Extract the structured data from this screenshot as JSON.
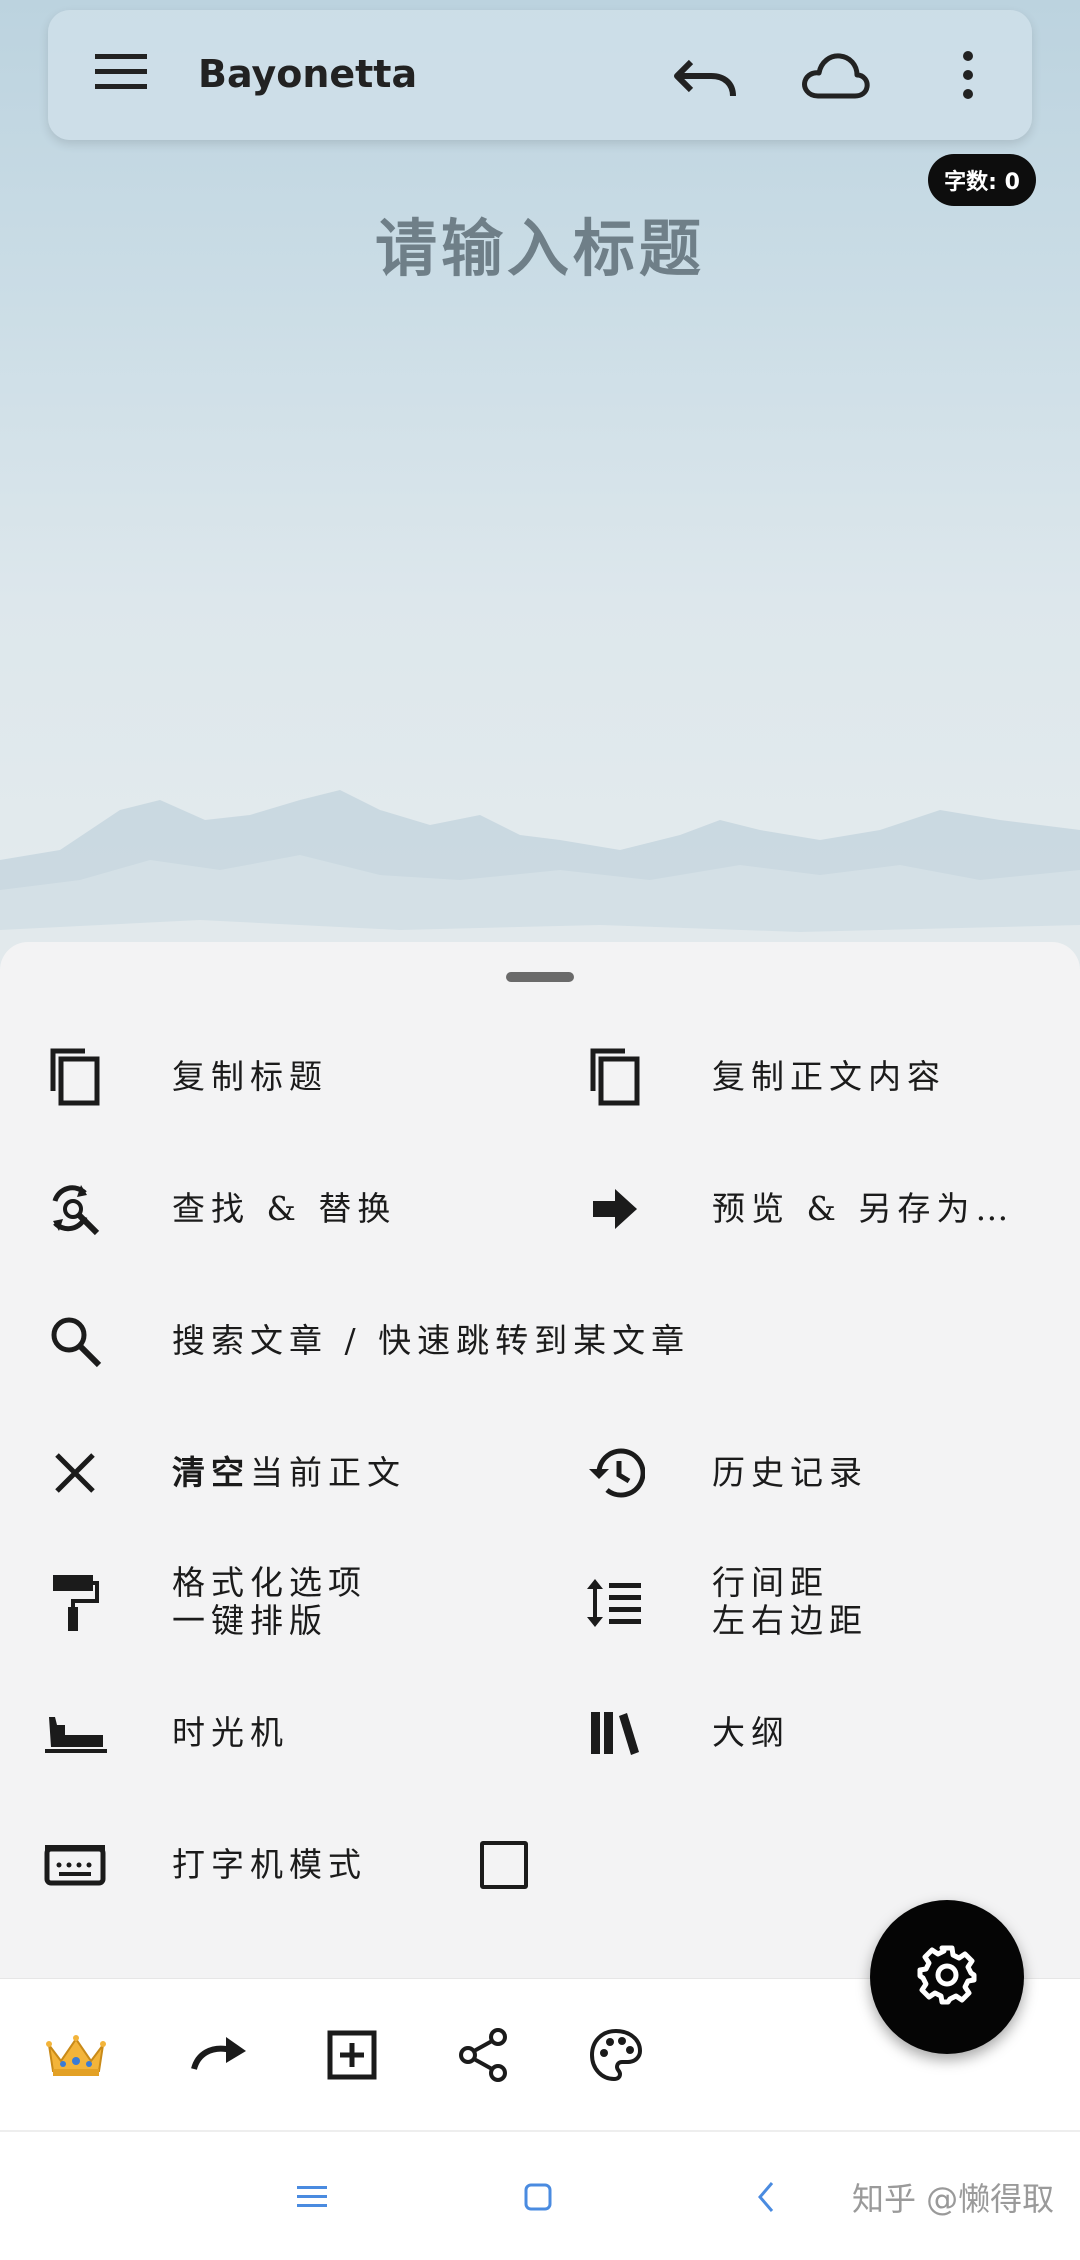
{
  "app": {
    "title": "Bayonetta",
    "word_count": "字数: 0",
    "title_placeholder": "请输入标题"
  },
  "menu": {
    "copy_title": "复制标题",
    "copy_body": "复制正文内容",
    "find_replace": "查找 & 替换",
    "preview_save": "预览 & 另存为…",
    "search_jump": "搜索文章 / 快速跳转到某文章",
    "clear_bold": "清空",
    "clear_rest": "当前正文",
    "history": "历史记录",
    "format_line1": "格式化选项",
    "format_line2": "一键排版",
    "spacing_line1": "行间距",
    "spacing_line2": "左右边距",
    "time_machine": "时光机",
    "outline": "大纲",
    "typewriter": "打字机模式",
    "typewriter_checked": false
  },
  "toolbar": {
    "icons": [
      "crown-icon",
      "redo-icon",
      "add-box-icon",
      "share-icon",
      "palette-icon"
    ]
  },
  "fab": {
    "icon": "settings-gear-icon"
  },
  "watermark": "知乎 @懒得取",
  "colors": {
    "accent": "#050505",
    "sheet_bg": "#f3f3f4",
    "word_count_bg": "#0d0d0d"
  }
}
